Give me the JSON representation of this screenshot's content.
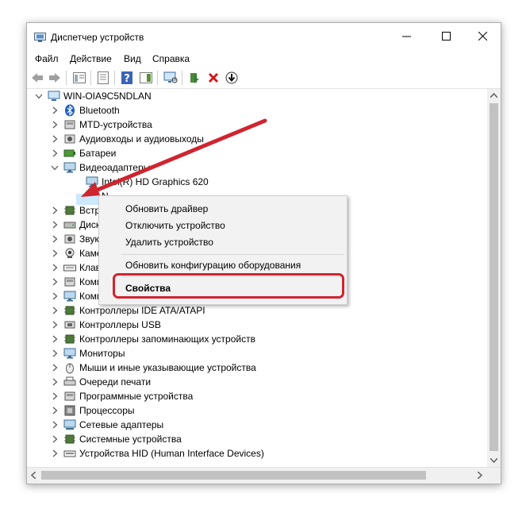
{
  "window": {
    "title": "Диспетчер устройств"
  },
  "menu": [
    "Файл",
    "Действие",
    "Вид",
    "Справка"
  ],
  "tree": {
    "root": "WIN-OIA9C5NDLAN",
    "items": [
      "Bluetooth",
      "MTD-устройства",
      "Аудиовходы и аудиовыходы",
      "Батареи",
      "Видеоадаптеры",
      "Intel(R) HD Graphics 620",
      "N",
      "Встр",
      "Диск",
      "Звук",
      "Каме",
      "Клав",
      "Комп",
      "Компьютер",
      "Контроллеры IDE ATA/ATAPI",
      "Контроллеры USB",
      "Контроллеры запоминающих устройств",
      "Мониторы",
      "Мыши и иные указывающие устройства",
      "Очереди печати",
      "Программные устройства",
      "Процессоры",
      "Сетевые адаптеры",
      "Системные устройства",
      "Устройства HID (Human Interface Devices)"
    ]
  },
  "context_menu": {
    "update_driver": "Обновить драйвер",
    "disable_device": "Отключить устройство",
    "uninstall_device": "Удалить устройство",
    "scan_hardware": "Обновить конфигурацию оборудования",
    "properties": "Свойства"
  },
  "colors": {
    "annotation": "#d0242f",
    "selection": "#cce8ff"
  }
}
